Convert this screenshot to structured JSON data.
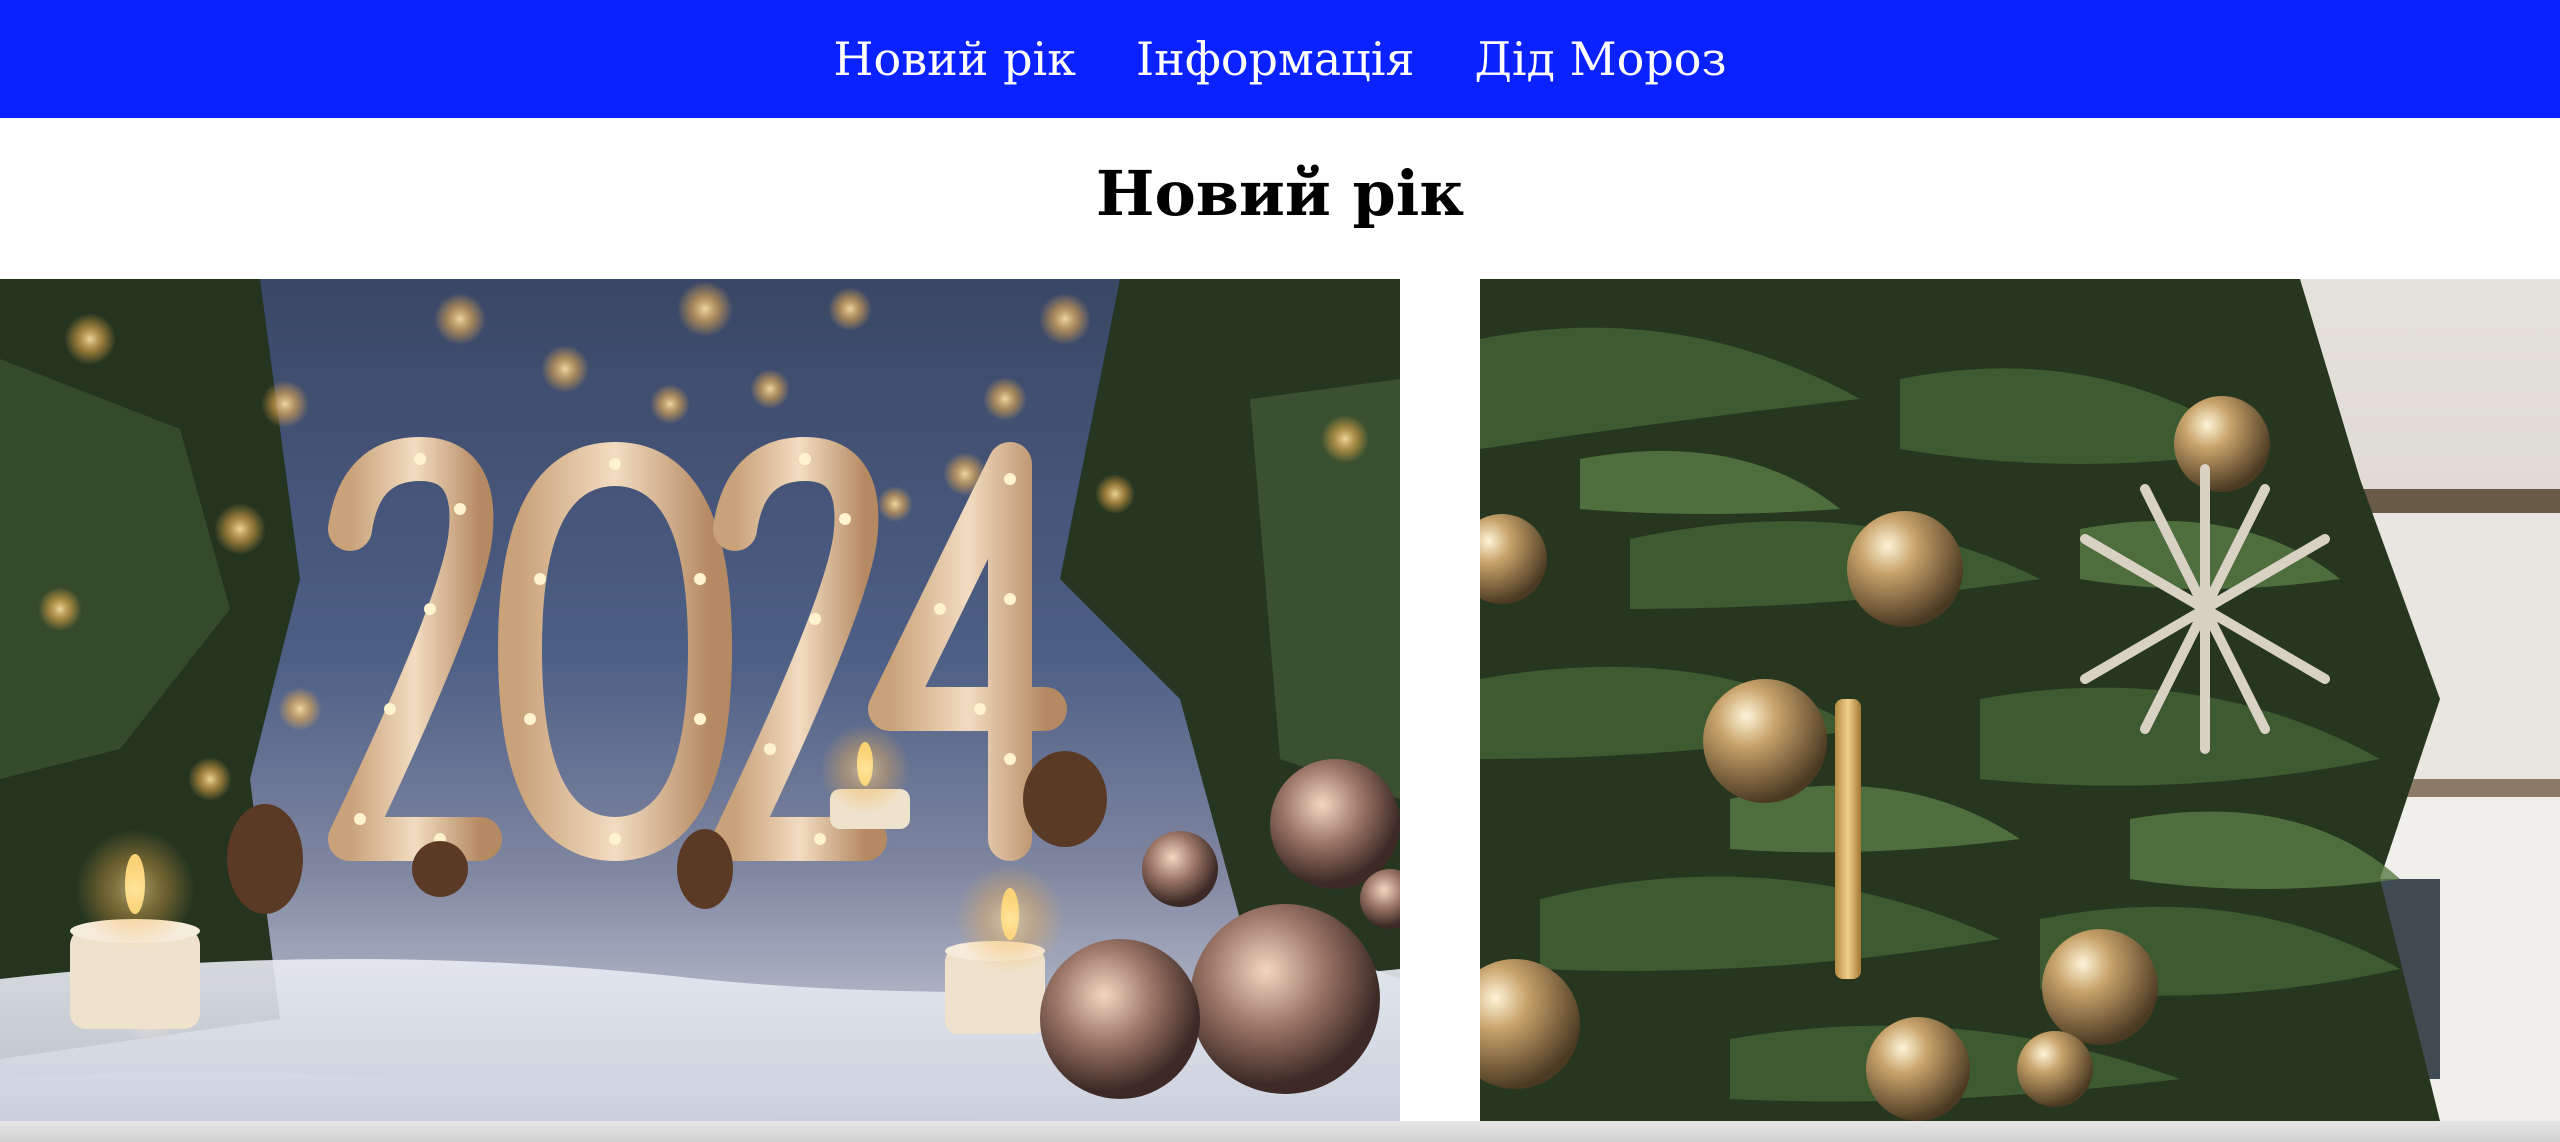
{
  "nav": {
    "items": [
      {
        "label": "Новий рік"
      },
      {
        "label": "Інформація"
      },
      {
        "label": "Дід Мороз"
      }
    ],
    "background": "#0a22ff"
  },
  "page": {
    "title": "Новий рік"
  },
  "gallery": {
    "images": [
      {
        "subject": "2024 illuminated marquee numbers with candles, pine cones and ornaments in snow",
        "sign_text": "2024"
      },
      {
        "subject": "decorated Christmas tree with gold baubles, a gold candle and a silver star ornament"
      }
    ]
  }
}
